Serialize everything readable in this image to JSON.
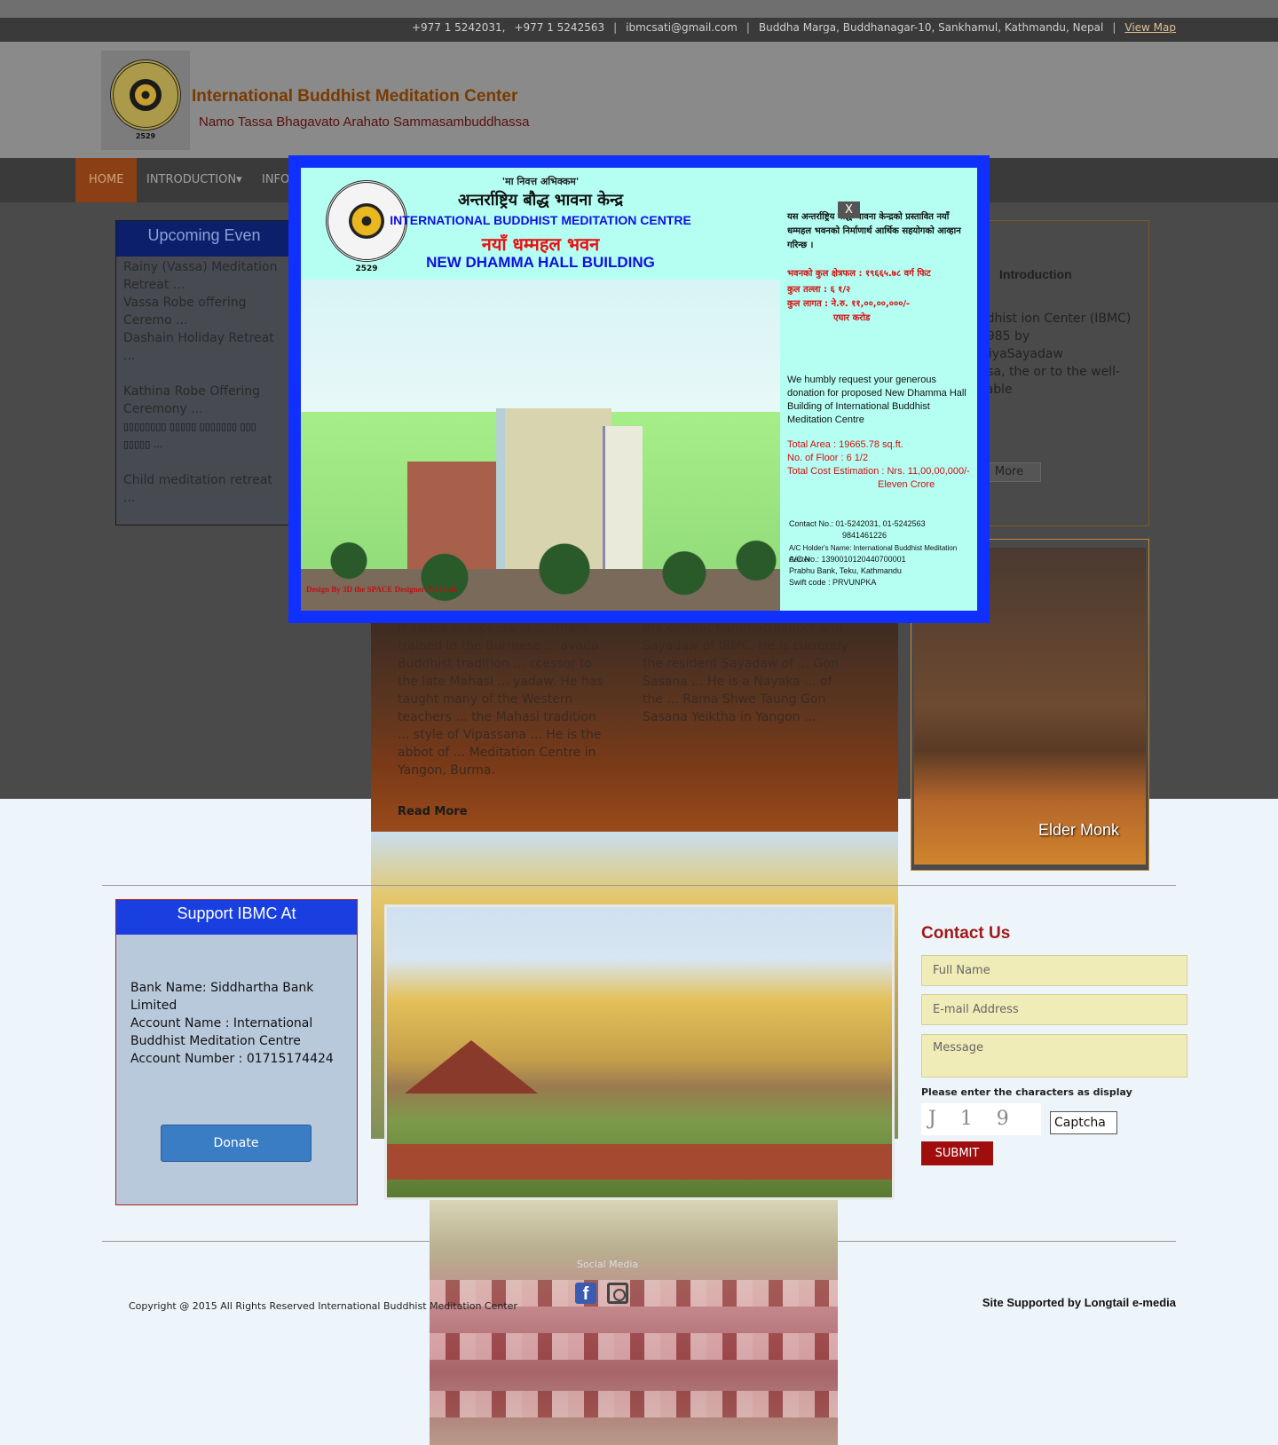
{
  "topbar": {
    "phone1": "+977 1 5242031,",
    "phone2": "+977 1 5242563",
    "email": "ibmcsati@gmail.com",
    "address": "Buddha Marga, Buddhanagar-10, Sankhamul, Kathmandu, Nepal",
    "map_link": "View Map"
  },
  "header": {
    "logo_year": "2529",
    "title": "International Buddhist Meditation Center",
    "tagline": "Namo Tassa Bhagavato Arahato Sammasambuddhassa"
  },
  "nav": {
    "items": [
      {
        "label": "HOME"
      },
      {
        "label": "INTRODUCTION"
      },
      {
        "label": "INFO"
      }
    ]
  },
  "events": {
    "heading": "Upcoming Even",
    "items": [
      {
        "label": "Rainy (Vassa) Meditation Retreat ..."
      },
      {
        "label": "Vassa Robe offering Ceremo ..."
      },
      {
        "label": "Dashain Holiday Retreat ..."
      },
      {
        "label": "Kathina Robe Offering Ceremony ..."
      },
      {
        "label": "▯▯▯▯▯▯▯▯ ▯▯▯▯▯ ▯▯▯▯▯▯▯ ▯▯▯ ▯▯▯▯▯ ..."
      },
      {
        "label": "Child meditation retreat ..."
      },
      {
        "label": "▯▯▯▯▯▯▯▯ ▯▯▯▯▯▯▯ ▯▯▯▯ ▯▯▯▯ ▯▯▯▯ ..."
      }
    ]
  },
  "intro": {
    "title": "Introduction",
    "text": "ional Buddhist ion Center (IBMC) nded in 1985 by tthānācariyaSayadaw tābhivamsa, the or to the well-known erable",
    "more_label": "More"
  },
  "monks": {
    "col1": "masters of Vipassana ... rmally trained in the Burmese ... avada Buddhist tradition ... ccessor to the late Mahasi ... yadaw. He has taught many of the Western teachers ... the Mahasi tradition ... style of Vipassana ... He is the abbot of ... Meditation Centre in Yangon, Burma.",
    "col2": "the current Kammatthanacharia Sayadaw of IBMC. He is currently the resident Sayadaw of ... Gon Sasana ... He is a Nayaka ... of the ... Rama Shwe Taung Gon Sasana Yeiktha in Yangon ...",
    "read_more": "Read More"
  },
  "elder": {
    "caption": "Elder Monk"
  },
  "support": {
    "heading": "Support IBMC At",
    "bank_name": "Bank Name: Siddhartha Bank Limited",
    "account_name": "Account Name : International Buddhist Meditation Centre",
    "account_number": "Account Number : 01715174424",
    "donate_label": "Donate"
  },
  "contact": {
    "title": "Contact Us",
    "full_name_placeholder": "Full Name",
    "email_placeholder": "E-mail Address",
    "message_placeholder": "Message",
    "captcha_label": "Please enter the characters as display",
    "captcha_chars": "J 1 9",
    "captcha_placeholder": "Captcha",
    "submit_label": "SUBMIT"
  },
  "footer": {
    "copyright": "Copyright @ 2015   All Rights Reserved   International Buddhist Meditation Center",
    "social_label": "Social Media",
    "site_support": "Site Supported by Longtail e-media"
  },
  "modal": {
    "close_label": "X",
    "motto": "'मा निवत्त अभिक्कम'",
    "dev_title": "अन्तर्राष्ट्रिय बौद्ध भावना केन्द्र",
    "en_title": "INTERNATIONAL BUDDHIST MEDITATION CENTRE",
    "dev_hall": "नयाँ धम्महल भवन",
    "en_hall": "NEW DHAMMA HALL BUILDING",
    "logo_year": "2529",
    "dev_request": "यस अन्तर्राष्ट्रिय बौद्ध भावना केन्द्रको प्रस्तावित नयाँ धम्महल भवनको निर्माणार्थ आर्थिक सहयोगको आव्हान गरिन्छ ।",
    "dev_area": "भवनको कुल क्षेत्रफल : १९६६५.७८ वर्ग फिट",
    "dev_floors": "कुल तल्ला : ६ १/२",
    "dev_cost": "कुल लागत : ने.रु. ११,००,००,०००/-",
    "dev_cost_words": "एघार करोड",
    "en_request": "We humbly request your generous donation for proposed New Dhamma Hall Building of International Buddhist Meditation Centre",
    "en_area": "Total Area : 19665.78 sq.ft.",
    "en_floors": "No. of Floor : 6 1/2",
    "en_cost": "Total Cost Estimation : Nrs. 11,00,00,000/-",
    "en_cost_words": "Eleven Crore",
    "contact_no": "Contact No.: 01-5242031, 01-5242563",
    "contact_mobile": "9841461226",
    "ac_holder": "A/C Holder's Name: International Buddhist Meditation Center",
    "ac_no": "A/C No.: 1390010120440700001",
    "bank": "Prabhu Bank, Teku, Kathmandu",
    "swift": "Swift code : PRVUNPKA",
    "design_credit": "Design By  3D  the SPACE Designers Pvt Ltd"
  }
}
